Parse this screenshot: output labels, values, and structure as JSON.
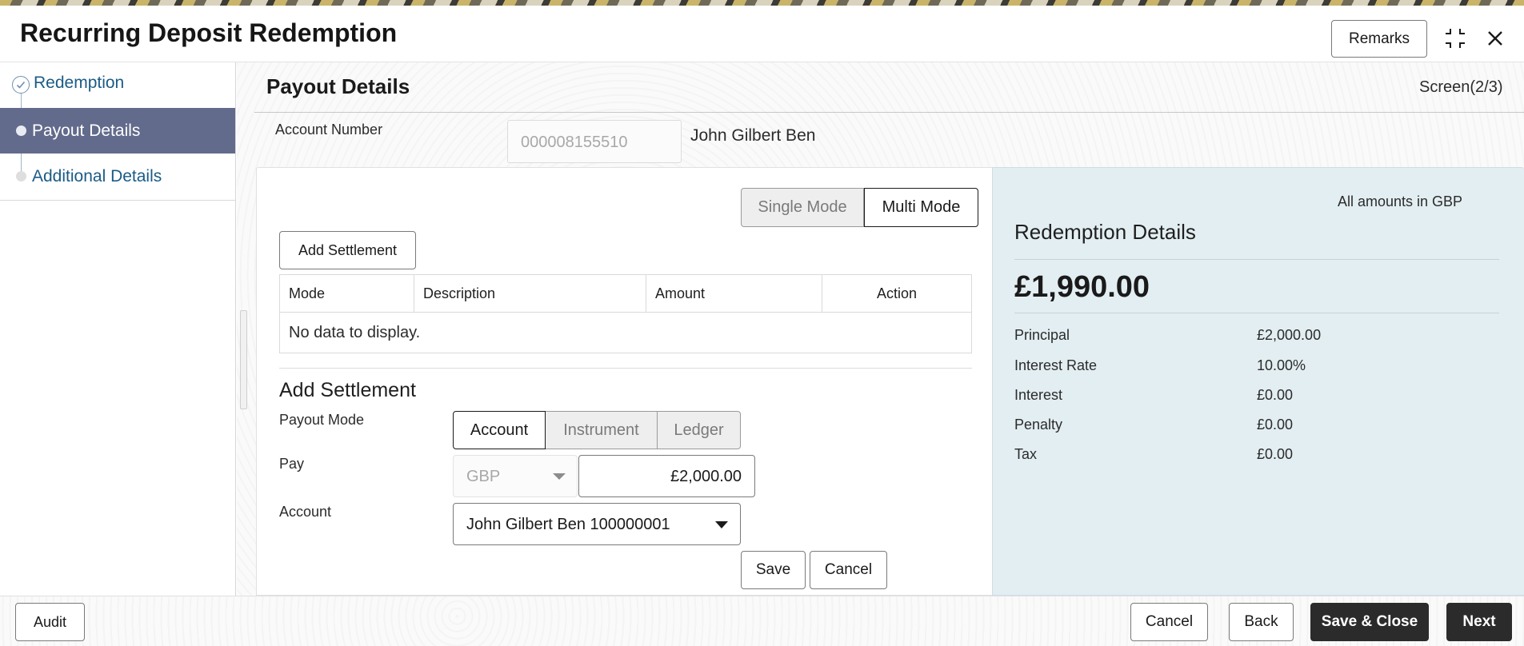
{
  "window": {
    "title": "Recurring Deposit Redemption",
    "remarks_label": "Remarks"
  },
  "icons": {
    "expand": "expand-icon",
    "close": "close-icon",
    "step_done": "check-circle-icon"
  },
  "sidebar": {
    "steps": [
      {
        "label": "Redemption",
        "state": "completed"
      },
      {
        "label": "Payout Details",
        "state": "active"
      },
      {
        "label": "Additional Details",
        "state": "pending"
      }
    ]
  },
  "main": {
    "title": "Payout Details",
    "screen_indicator": "Screen(2/3)",
    "account_number_label": "Account Number",
    "account_number_value": "000008155510",
    "account_holder": "John Gilbert Ben",
    "modes": {
      "single": "Single Mode",
      "multi": "Multi Mode",
      "selected": "Multi Mode"
    },
    "add_settlement_button": "Add Settlement",
    "grid": {
      "columns": [
        "Mode",
        "Description",
        "Amount",
        "Action"
      ],
      "empty_text": "No data to display."
    },
    "form": {
      "title": "Add Settlement",
      "payout_mode_label": "Payout Mode",
      "payout_modes": [
        "Account",
        "Instrument",
        "Ledger"
      ],
      "payout_mode_selected": "Account",
      "pay_label": "Pay",
      "currency": "GBP",
      "amount": "£2,000.00",
      "account_label": "Account",
      "account_value": "John Gilbert Ben 100000001",
      "save_label": "Save",
      "cancel_label": "Cancel"
    }
  },
  "redemption_panel": {
    "note": "All amounts in GBP",
    "title": "Redemption Details",
    "total": "£1,990.00",
    "rows": [
      {
        "label": "Principal",
        "value": "£2,000.00"
      },
      {
        "label": "Interest Rate",
        "value": "10.00%"
      },
      {
        "label": "Interest",
        "value": "£0.00"
      },
      {
        "label": "Penalty",
        "value": "£0.00"
      },
      {
        "label": "Tax",
        "value": "£0.00"
      }
    ]
  },
  "footer": {
    "audit_label": "Audit",
    "cancel_label": "Cancel",
    "back_label": "Back",
    "save_close_label": "Save & Close",
    "next_label": "Next"
  },
  "colors": {
    "active_step_bg": "#636b8c",
    "link_text": "#1a5b86",
    "panel_bg": "#e3eef2",
    "primary_button": "#2b2b2b"
  }
}
